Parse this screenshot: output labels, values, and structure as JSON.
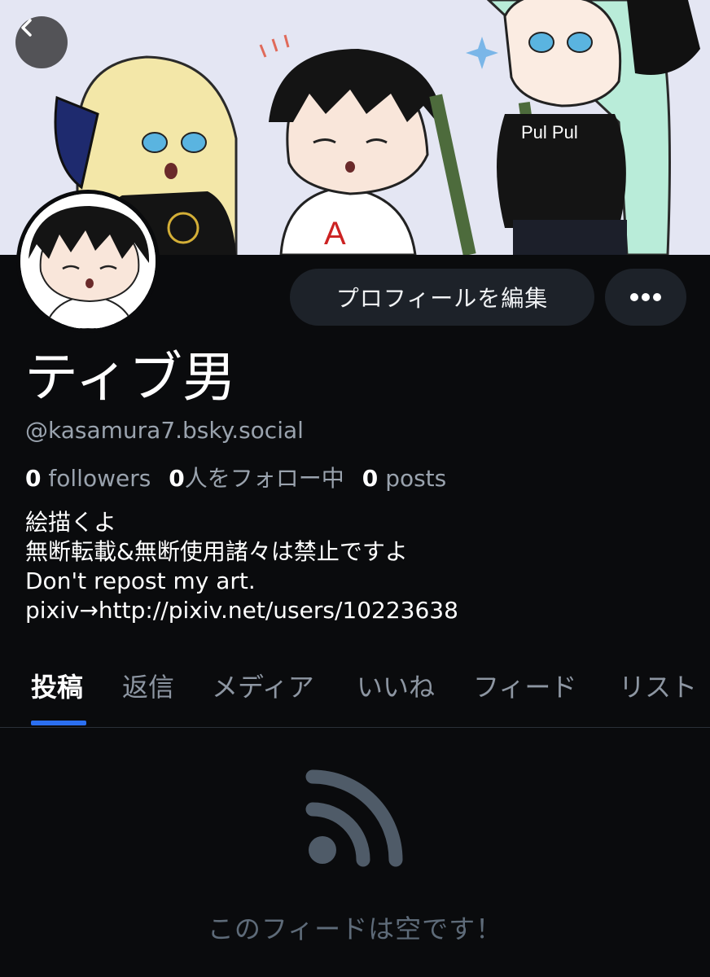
{
  "header": {
    "back_icon": "chevron-left-icon"
  },
  "profile": {
    "display_name": "ティブ男",
    "handle": "@kasamura7.bsky.social",
    "edit_button_label": "プロフィールを編集",
    "more_icon": "ellipsis-horizontal-icon"
  },
  "stats": {
    "followers_count": "0",
    "followers_label": "followers",
    "following_count": "0",
    "following_label": "人をフォロー中",
    "posts_count": "0",
    "posts_label": "posts"
  },
  "bio": {
    "lines": [
      "絵描くよ",
      "無断転載&無断使用諸々は禁止ですよ",
      "Don't repost my art.",
      "pixiv→http://pixiv.net/users/10223638"
    ]
  },
  "tabs": [
    {
      "label": "投稿",
      "active": true
    },
    {
      "label": "返信",
      "active": false
    },
    {
      "label": "メディア",
      "active": false
    },
    {
      "label": "いいね",
      "active": false
    },
    {
      "label": "フィード",
      "active": false
    },
    {
      "label": "リスト",
      "active": false
    }
  ],
  "feed": {
    "empty_icon": "rss-feed-icon",
    "empty_message": "このフィードは空です！"
  },
  "colors": {
    "accent": "#2b6ff0",
    "background": "#0a0b0d",
    "button_bg": "#1d2229",
    "muted_text": "#9aa3ae"
  }
}
